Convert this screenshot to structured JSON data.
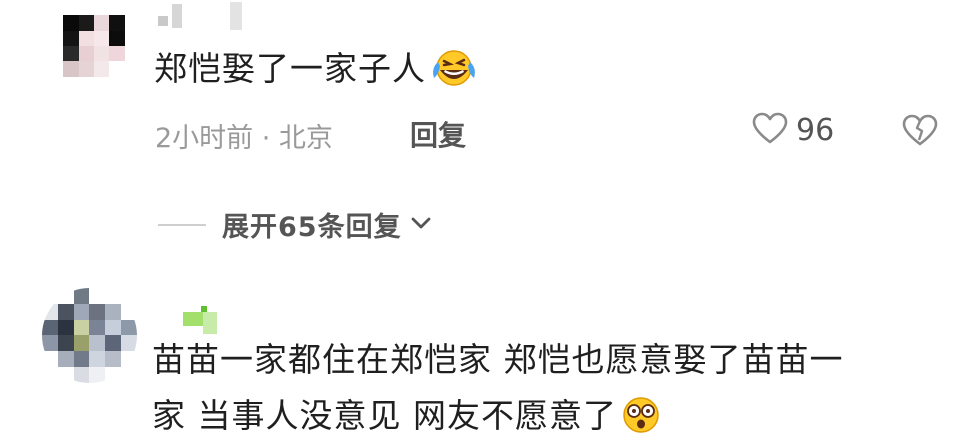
{
  "comments": [
    {
      "text": "郑恺娶了一家子人",
      "emoji": "laughing-crying-emoji",
      "meta": "2小时前 · 北京",
      "reply_label": "回复",
      "likes": "96",
      "expand_label": "展开65条回复"
    },
    {
      "text_line1": "苗苗一家都住在郑恺家 郑恺也愿意娶了苗苗一",
      "text_line2": "家 当事人没意见 网友不愿意了",
      "emoji": "shocked-emoji"
    }
  ]
}
